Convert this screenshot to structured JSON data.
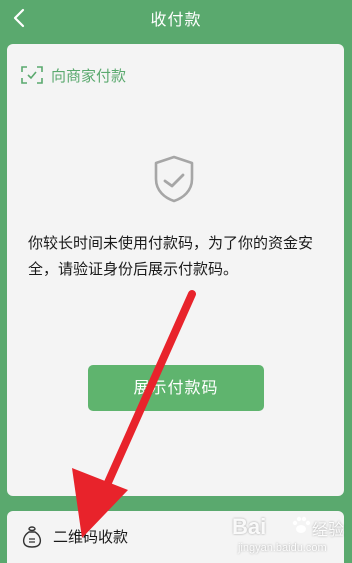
{
  "header": {
    "title": "收付款",
    "back_icon": "chevron-left-icon"
  },
  "card": {
    "merchant_pay_label": "向商家付款",
    "merchant_pay_icon": "scan-frame-icon",
    "shield_icon": "shield-check-icon",
    "message": "你较长时间未使用付款码，为了你的资金安全，请验证身份后展示付款码。",
    "show_button_label": "展示付款码"
  },
  "bottom_bar": {
    "label": "二维码收款",
    "icon": "money-bag-icon"
  },
  "watermark": {
    "logo_text": "Bai",
    "jingyan_text": "经验",
    "url": "jingyan.baidu.com"
  },
  "colors": {
    "brand_green": "#5aa96e",
    "button_green": "#5fb46e",
    "annotation_red": "#e8232b"
  }
}
